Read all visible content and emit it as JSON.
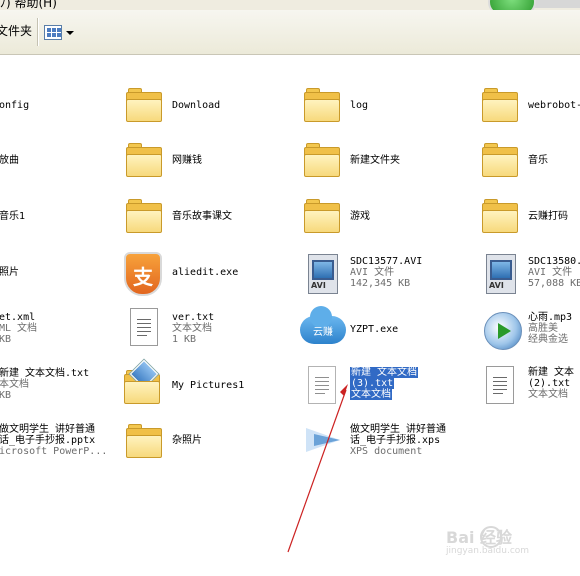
{
  "window": {
    "menu_visible": "ﾉ)    帮助(H)",
    "folders_button": "文件夹"
  },
  "files": [
    {
      "name": "onfig"
    },
    {
      "name": "Download"
    },
    {
      "name": "log"
    },
    {
      "name": "webrobot-"
    },
    {
      "name": "放曲"
    },
    {
      "name": "网赚钱"
    },
    {
      "name": "新建文件夹"
    },
    {
      "name": "音乐"
    },
    {
      "name": "音乐1"
    },
    {
      "name": "音乐故事课文"
    },
    {
      "name": "游戏"
    },
    {
      "name": "云赚打码"
    },
    {
      "name": "照片"
    },
    {
      "name": "aliedit.exe"
    },
    {
      "name": "SDC13577.AVI",
      "type": "AVI 文件",
      "size": "142,345 KB"
    },
    {
      "name": "SDC13580.",
      "type": "AVI 文件",
      "size": "57,088 KB"
    },
    {
      "name": "et.xml",
      "type": "ML 文档",
      "size": "KB"
    },
    {
      "name": "ver.txt",
      "type": "文本文档",
      "size": "1 KB"
    },
    {
      "name": "YZPT.exe",
      "icon_text": "云赚"
    },
    {
      "name": "心雨.mp3",
      "type": "高胜美",
      "size": "经典金选"
    },
    {
      "name": "新建 文本文档.txt",
      "type": "本文档",
      "size": "KB"
    },
    {
      "name": "My Pictures1"
    },
    {
      "name": "新建 文本文档",
      "name2": "(3).txt",
      "type": "文本文档"
    },
    {
      "name": "新建 文本",
      "name2": "(2).txt",
      "type": "文本文档"
    },
    {
      "name": "做文明学生_讲好普通",
      "name2": "话_电子手抄报.pptx",
      "type": "icrosoft PowerP..."
    },
    {
      "name": "杂照片"
    },
    {
      "name": "做文明学生_讲好普通",
      "name2": "话_电子手抄报.xps",
      "type": "XPS document"
    }
  ],
  "watermark": {
    "brand": "Bai 经验",
    "site": "jingyan.baidu.com"
  },
  "colors": {
    "selection": "#316ac5",
    "arrow": "#cc2222",
    "folder": "#f0c048"
  }
}
